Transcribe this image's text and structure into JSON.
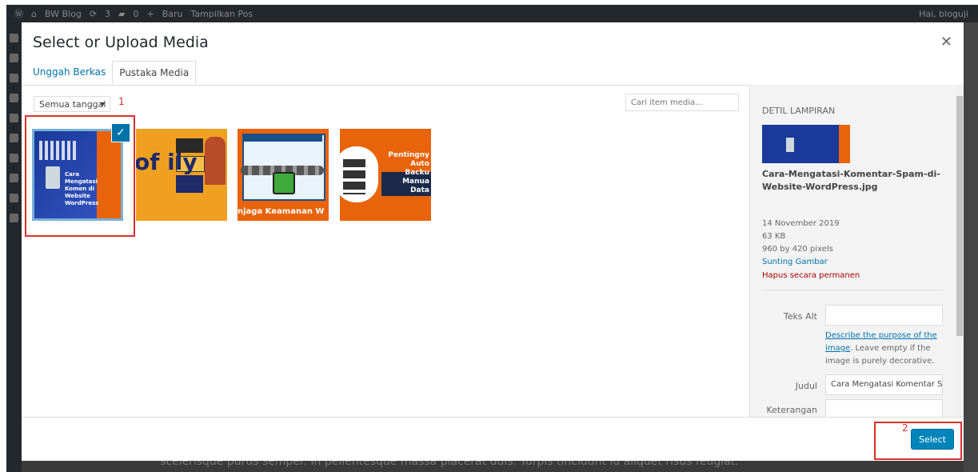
{
  "adminbar": {
    "site_name": "BW Blog",
    "updates": "3",
    "comments": "0",
    "new_label": "Baru",
    "view_post": "Tampilkan Pos",
    "greeting": "Hai, bloguji"
  },
  "background": {
    "text": "scelerisque purus semper. In pellentesque massa placerat duis. Turpis tincidunt id aliquet risus feugiat."
  },
  "modal": {
    "title": "Select or Upload Media",
    "close_icon": "close-icon"
  },
  "tabs": [
    {
      "label": "Unggah Berkas",
      "active": false
    },
    {
      "label": "Pustaka Media",
      "active": true
    }
  ],
  "toolbar": {
    "date_filter_value": "Semua tanggal",
    "search_placeholder": "Cari item media...",
    "annotation_1": "1"
  },
  "media_items": [
    {
      "caption": "Cara Mengatasi Komentar di Website WordPress",
      "selected": true
    },
    {
      "caption": "of ...ily",
      "selected": false
    },
    {
      "caption": "njaga Keamanan W",
      "selected": false
    },
    {
      "caption": "Pentingny Auto Backu Manua Data",
      "selected": false
    }
  ],
  "thumb_text": {
    "t1": "Cara Mengatasi Komen di Website WordPress",
    "t2": "of ily",
    "t3": "njaga Keamanan W",
    "t4": "Pentingny Auto Backu Manua Data"
  },
  "details": {
    "heading": "DETIL LAMPIRAN",
    "filename": "Cara-Mengatasi-Komentar-Spam-di-Website-WordPress.jpg",
    "date": "14 November 2019",
    "size": "63 KB",
    "dimensions": "960 by 420 pixels",
    "edit_link": "Sunting Gambar",
    "delete_link": "Hapus secara permanen",
    "alt_label": "Teks Alt",
    "alt_value": "",
    "alt_desc_link": "Describe the purpose of the image",
    "alt_desc_rest": ". Leave empty if the image is purely decorative.",
    "title_label": "Judul",
    "title_value": "Cara Mengatasi Komentar S",
    "caption_label": "Keterangan",
    "caption_value": ""
  },
  "footer": {
    "select_label": "Select",
    "annotation_2": "2"
  },
  "colors": {
    "accent": "#0073aa",
    "button": "#0085ba",
    "highlight": "#d9302c",
    "delete": "#aa0000"
  }
}
